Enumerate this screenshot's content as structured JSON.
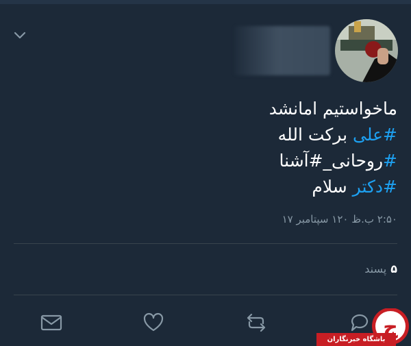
{
  "tweet": {
    "lines": [
      {
        "text": "ماخواستیم امانشد"
      },
      {
        "tag": "#علی",
        "text": " برکت الله"
      },
      {
        "tag": "#روحانی_#آشنا",
        "text": ""
      },
      {
        "tag": "#دکتر",
        "text": " سلام"
      }
    ],
    "timestamp": "۲:۵۰ ب.ظ ۱۲۰ سپتامبر ۱۷"
  },
  "stats": {
    "likes_count": "۵",
    "likes_label": "پسند"
  },
  "actions": {
    "reply_icon": "reply-icon",
    "retweet_icon": "retweet-icon",
    "like_icon": "like-icon",
    "dm_icon": "mail-icon"
  },
  "icons": {
    "menu": "chevron-down-icon"
  },
  "watermark": {
    "text": "باشگاه خبرنگاران",
    "color": "#c81e24"
  },
  "colors": {
    "background": "#1c2938",
    "hashtag": "#1da1f2",
    "muted": "#8899a6"
  }
}
